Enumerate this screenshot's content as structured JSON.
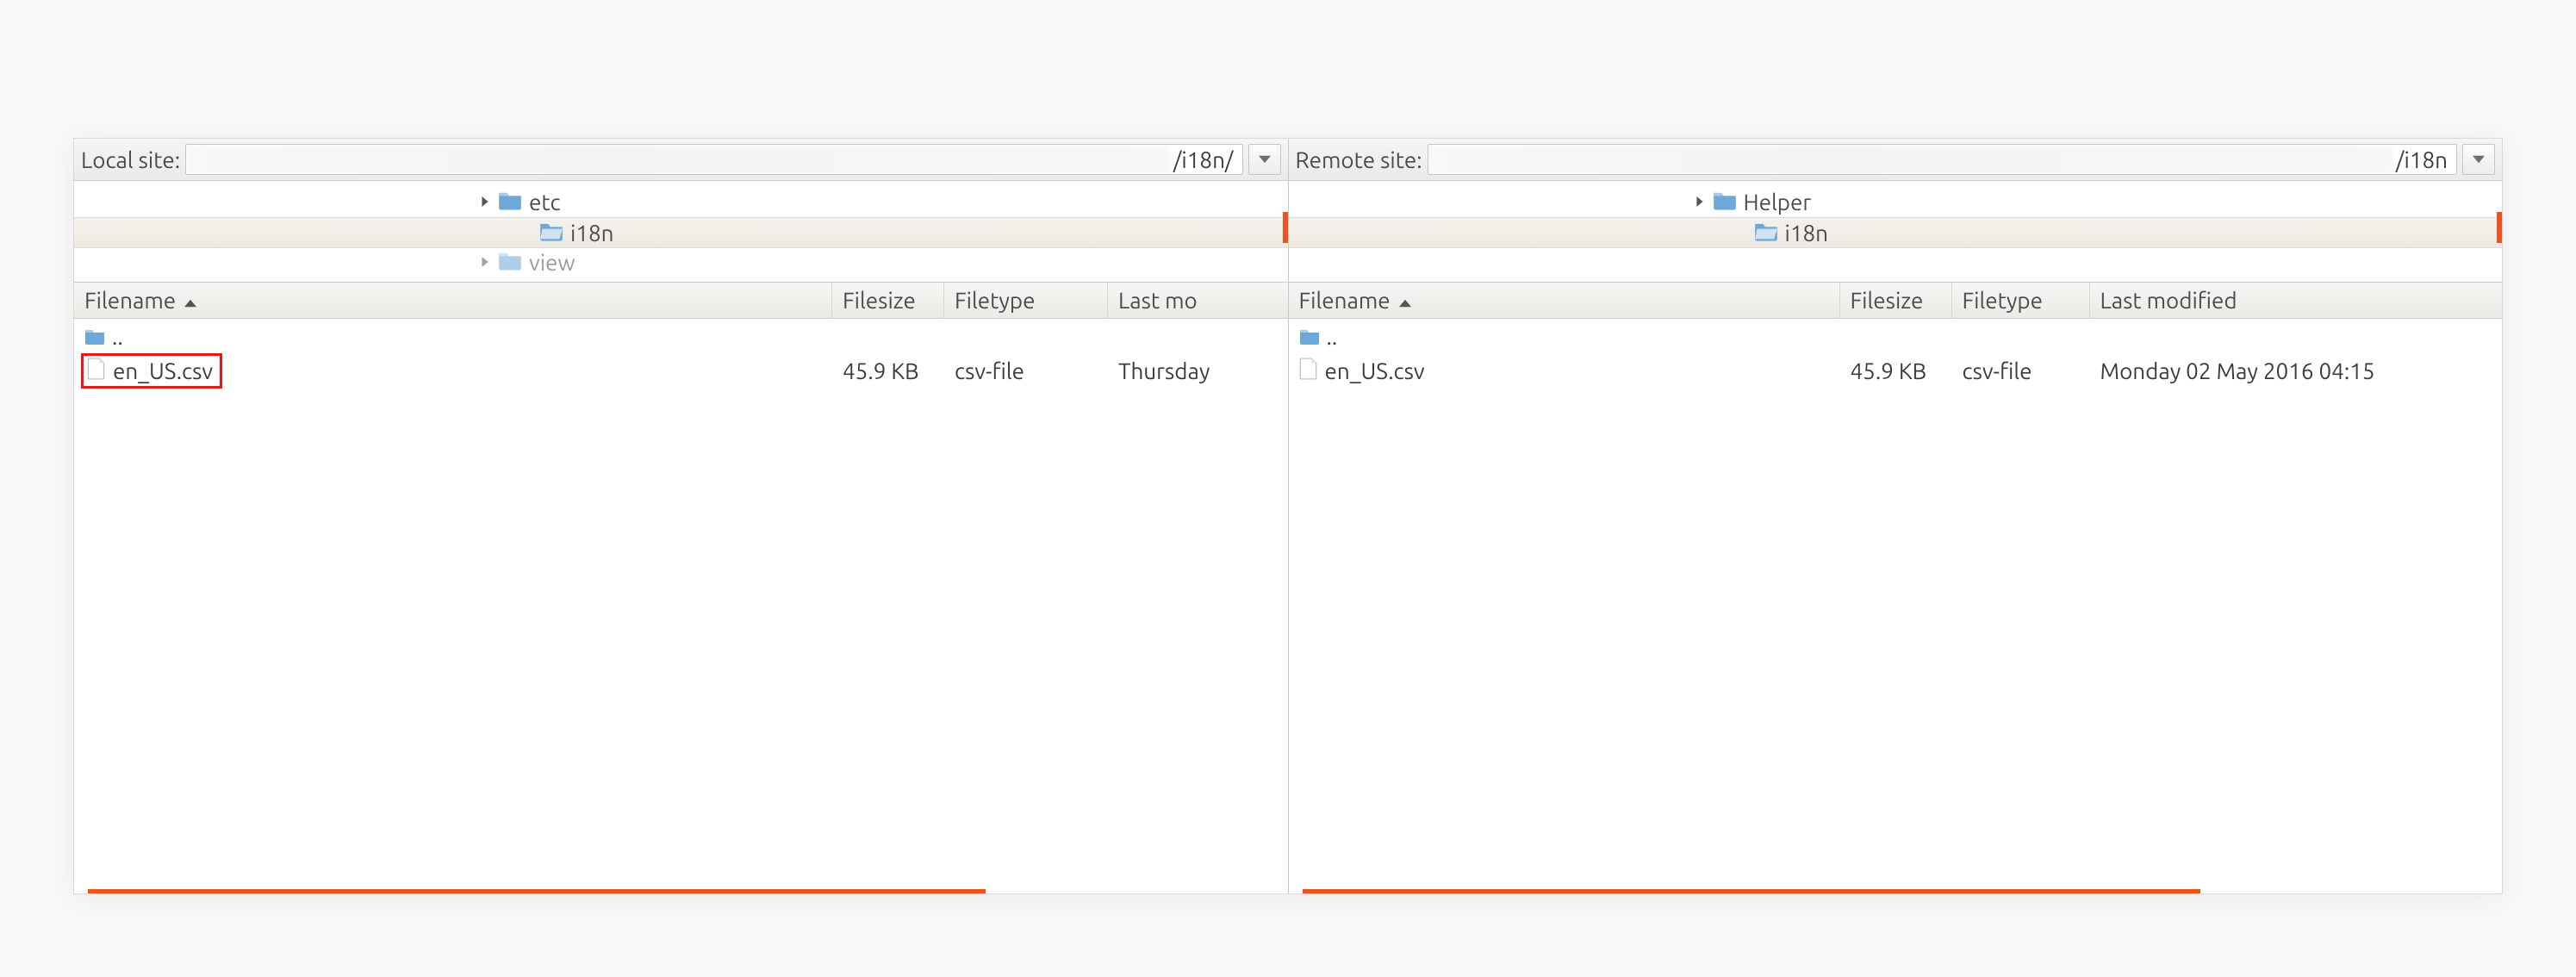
{
  "local": {
    "label": "Local site:",
    "path_tail": "/i18n/",
    "tree": [
      {
        "name": "etc",
        "icon": "folder",
        "expandable": true,
        "indent": 1
      },
      {
        "name": "i18n",
        "icon": "folder-open",
        "expandable": false,
        "indent": 2,
        "selected": true
      },
      {
        "name": "view",
        "icon": "folder",
        "expandable": true,
        "indent": 1,
        "clipped": true
      }
    ],
    "columns": {
      "filename": "Filename",
      "filesize": "Filesize",
      "filetype": "Filetype",
      "lastmod": "Last mo"
    },
    "rows": [
      {
        "name": "..",
        "icon": "folder",
        "size": "",
        "type": "",
        "modified": ""
      },
      {
        "name": "en_US.csv",
        "icon": "file",
        "size": "45.9 KB",
        "type": "csv-file",
        "modified": "Thursday",
        "highlighted": true
      }
    ]
  },
  "remote": {
    "label": "Remote site:",
    "path_tail": "/i18n",
    "tree": [
      {
        "name": "Helper",
        "icon": "folder",
        "expandable": true,
        "indent": 1
      },
      {
        "name": "i18n",
        "icon": "folder-open",
        "expandable": false,
        "indent": 2,
        "selected": true
      }
    ],
    "columns": {
      "filename": "Filename",
      "filesize": "Filesize",
      "filetype": "Filetype",
      "lastmod": "Last modified"
    },
    "rows": [
      {
        "name": "..",
        "icon": "folder",
        "size": "",
        "type": "",
        "modified": ""
      },
      {
        "name": "en_US.csv",
        "icon": "file",
        "size": "45.9 KB",
        "type": "csv-file",
        "modified": "Monday 02 May 2016 04:15"
      }
    ]
  }
}
